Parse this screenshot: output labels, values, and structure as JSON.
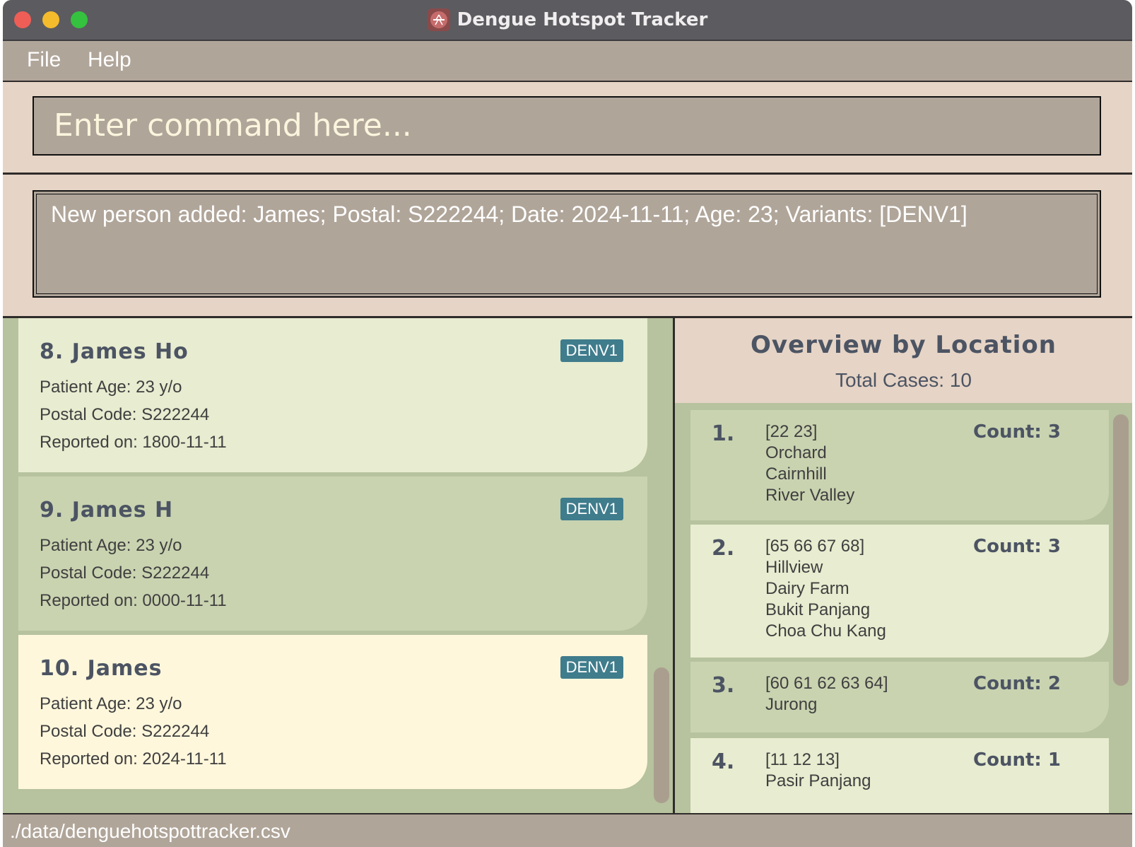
{
  "window": {
    "title": "Dengue Hotspot Tracker"
  },
  "menu": {
    "file": "File",
    "help": "Help"
  },
  "command": {
    "placeholder": "Enter command here..."
  },
  "result": {
    "text": "New person added: James; Postal: S222244; Date: 2024-11-11; Age: 23; Variants: [DENV1]"
  },
  "persons": [
    {
      "title": "8. James Ho",
      "variant": "DENV1",
      "age": "Patient Age: 23 y/o",
      "postal": "Postal Code: S222244",
      "reported": "Reported on: 1800-11-11"
    },
    {
      "title": "9. James H",
      "variant": "DENV1",
      "age": "Patient Age: 23 y/o",
      "postal": "Postal Code: S222244",
      "reported": "Reported on: 0000-11-11"
    },
    {
      "title": "10. James",
      "variant": "DENV1",
      "age": "Patient Age: 23 y/o",
      "postal": "Postal Code: S222244",
      "reported": "Reported on: 2024-11-11"
    }
  ],
  "overview": {
    "title": "Overview by Location",
    "total": "Total Cases: 10",
    "locations": [
      {
        "rank": "1.",
        "lines": [
          "[22 23]",
          "Orchard",
          "Cairnhill",
          "River Valley"
        ],
        "count": "Count: 3"
      },
      {
        "rank": "2.",
        "lines": [
          "[65 66 67 68]",
          "Hillview",
          "Dairy Farm",
          "Bukit Panjang",
          "Choa Chu Kang"
        ],
        "count": "Count: 3"
      },
      {
        "rank": "3.",
        "lines": [
          "[60 61 62 63 64]",
          "Jurong"
        ],
        "count": "Count: 2"
      },
      {
        "rank": "4.",
        "lines": [
          "[11 12 13]",
          "Pasir Panjang"
        ],
        "count": "Count: 1"
      }
    ]
  },
  "status": {
    "path": "./data/denguehotspottracker.csv"
  },
  "colors": {
    "card_light": "#e8ecd0",
    "card_mid": "#c9d3b0",
    "card_selected": "#fff7dc",
    "tag": "#3f7c8c"
  }
}
